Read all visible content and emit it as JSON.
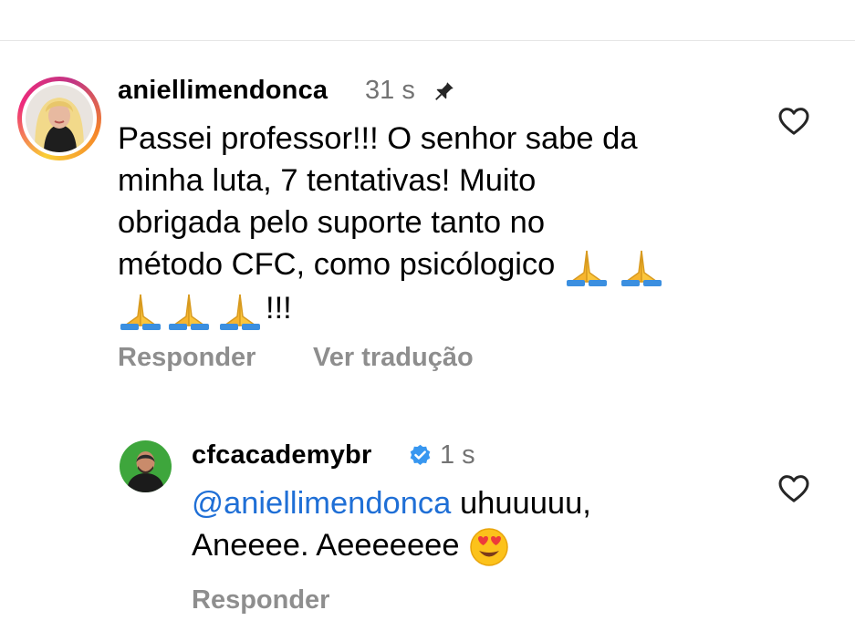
{
  "comment": {
    "username": "aniellimendonca",
    "time": "31 s",
    "lines": [
      "Passei professor!!! O senhor sabe da",
      "minha luta, 7 tentativas! Muito",
      "obrigada pelo suporte tanto no",
      "método CFC, como psicólogico"
    ],
    "last_line_suffix": "!!!",
    "reply_label": "Responder",
    "translate_label": "Ver tradução"
  },
  "reply": {
    "username": "cfcacademybr",
    "time": "1 s",
    "mention": "@aniellimendonca",
    "text_line1": " uhuuuuu,",
    "text_line2": "Aneeee. Aeeeeeee",
    "reply_label": "Responder"
  },
  "icons": {
    "pin": "pin-icon",
    "heart": "heart-outline-icon",
    "verified": "verified-badge-icon",
    "pray": "folded-hands-emoji",
    "heart_eyes": "heart-eyes-emoji"
  },
  "colors": {
    "mention": "#1f6fd6",
    "secondary_text": "#737373",
    "action_text": "#8e8e8e",
    "verified": "#3897f0"
  }
}
